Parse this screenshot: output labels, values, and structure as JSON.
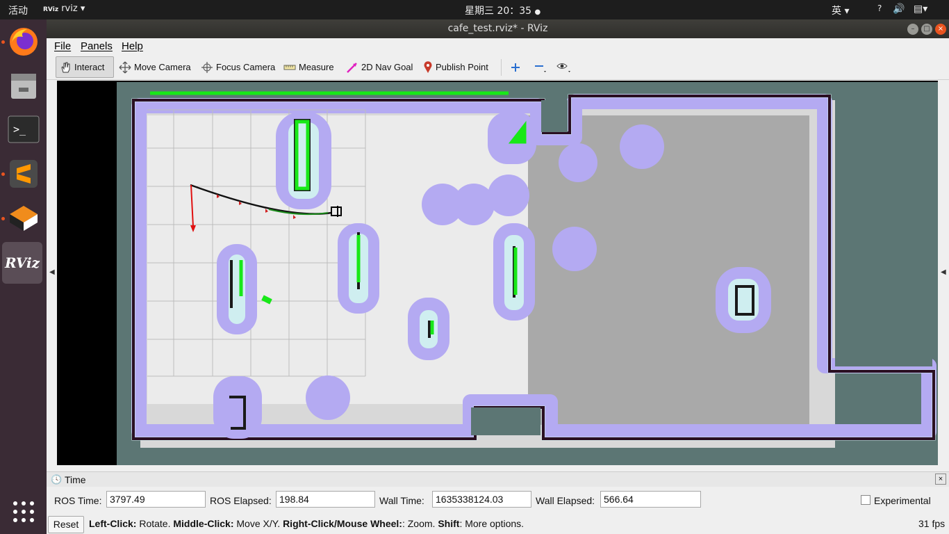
{
  "topbar": {
    "activities": "活动",
    "app_name": "rviz",
    "clock": "星期三 20：35",
    "input_method": "英",
    "help": "?"
  },
  "window": {
    "title": "cafe_test.rviz* - RViz"
  },
  "menu": {
    "file": "File",
    "panels": "Panels",
    "help": "Help"
  },
  "toolbar": {
    "interact": "Interact",
    "move_camera": "Move Camera",
    "focus_camera": "Focus Camera",
    "measure": "Measure",
    "nav_goal": "2D Nav Goal",
    "publish_point": "Publish Point"
  },
  "time_panel": {
    "title": "Time",
    "ros_time_label": "ROS Time:",
    "ros_time_value": "3797.49",
    "ros_elapsed_label": "ROS Elapsed:",
    "ros_elapsed_value": "198.84",
    "wall_time_label": "Wall Time:",
    "wall_time_value": "1635338124.03",
    "wall_elapsed_label": "Wall Elapsed:",
    "wall_elapsed_value": "566.64",
    "experimental_label": "Experimental"
  },
  "status": {
    "reset_label": "Reset",
    "left_click": "Left-Click:",
    "rotate": " Rotate. ",
    "middle_click": "Middle-Click:",
    "move_xy": " Move X/Y. ",
    "right_click": "Right-Click/Mouse Wheel:",
    "zoom": ": Zoom. ",
    "shift": "Shift",
    "more_options": ": More options.",
    "fps": "31 fps"
  },
  "colors": {
    "accent": "#e95420",
    "map_free": "#e8e8e8",
    "map_unknown": "#5e7c7a",
    "obstacle": "#1a1a1a",
    "costmap_halo": "#b8b0f0",
    "inflated": "#c8f0f0",
    "laser_green": "#18e818",
    "path": "#111111",
    "axis_red": "#e01010"
  },
  "icons": [
    "firefox-icon",
    "files-icon",
    "terminal-icon",
    "sublime-icon",
    "software-icon",
    "rviz-icon",
    "app-grid-icon"
  ]
}
